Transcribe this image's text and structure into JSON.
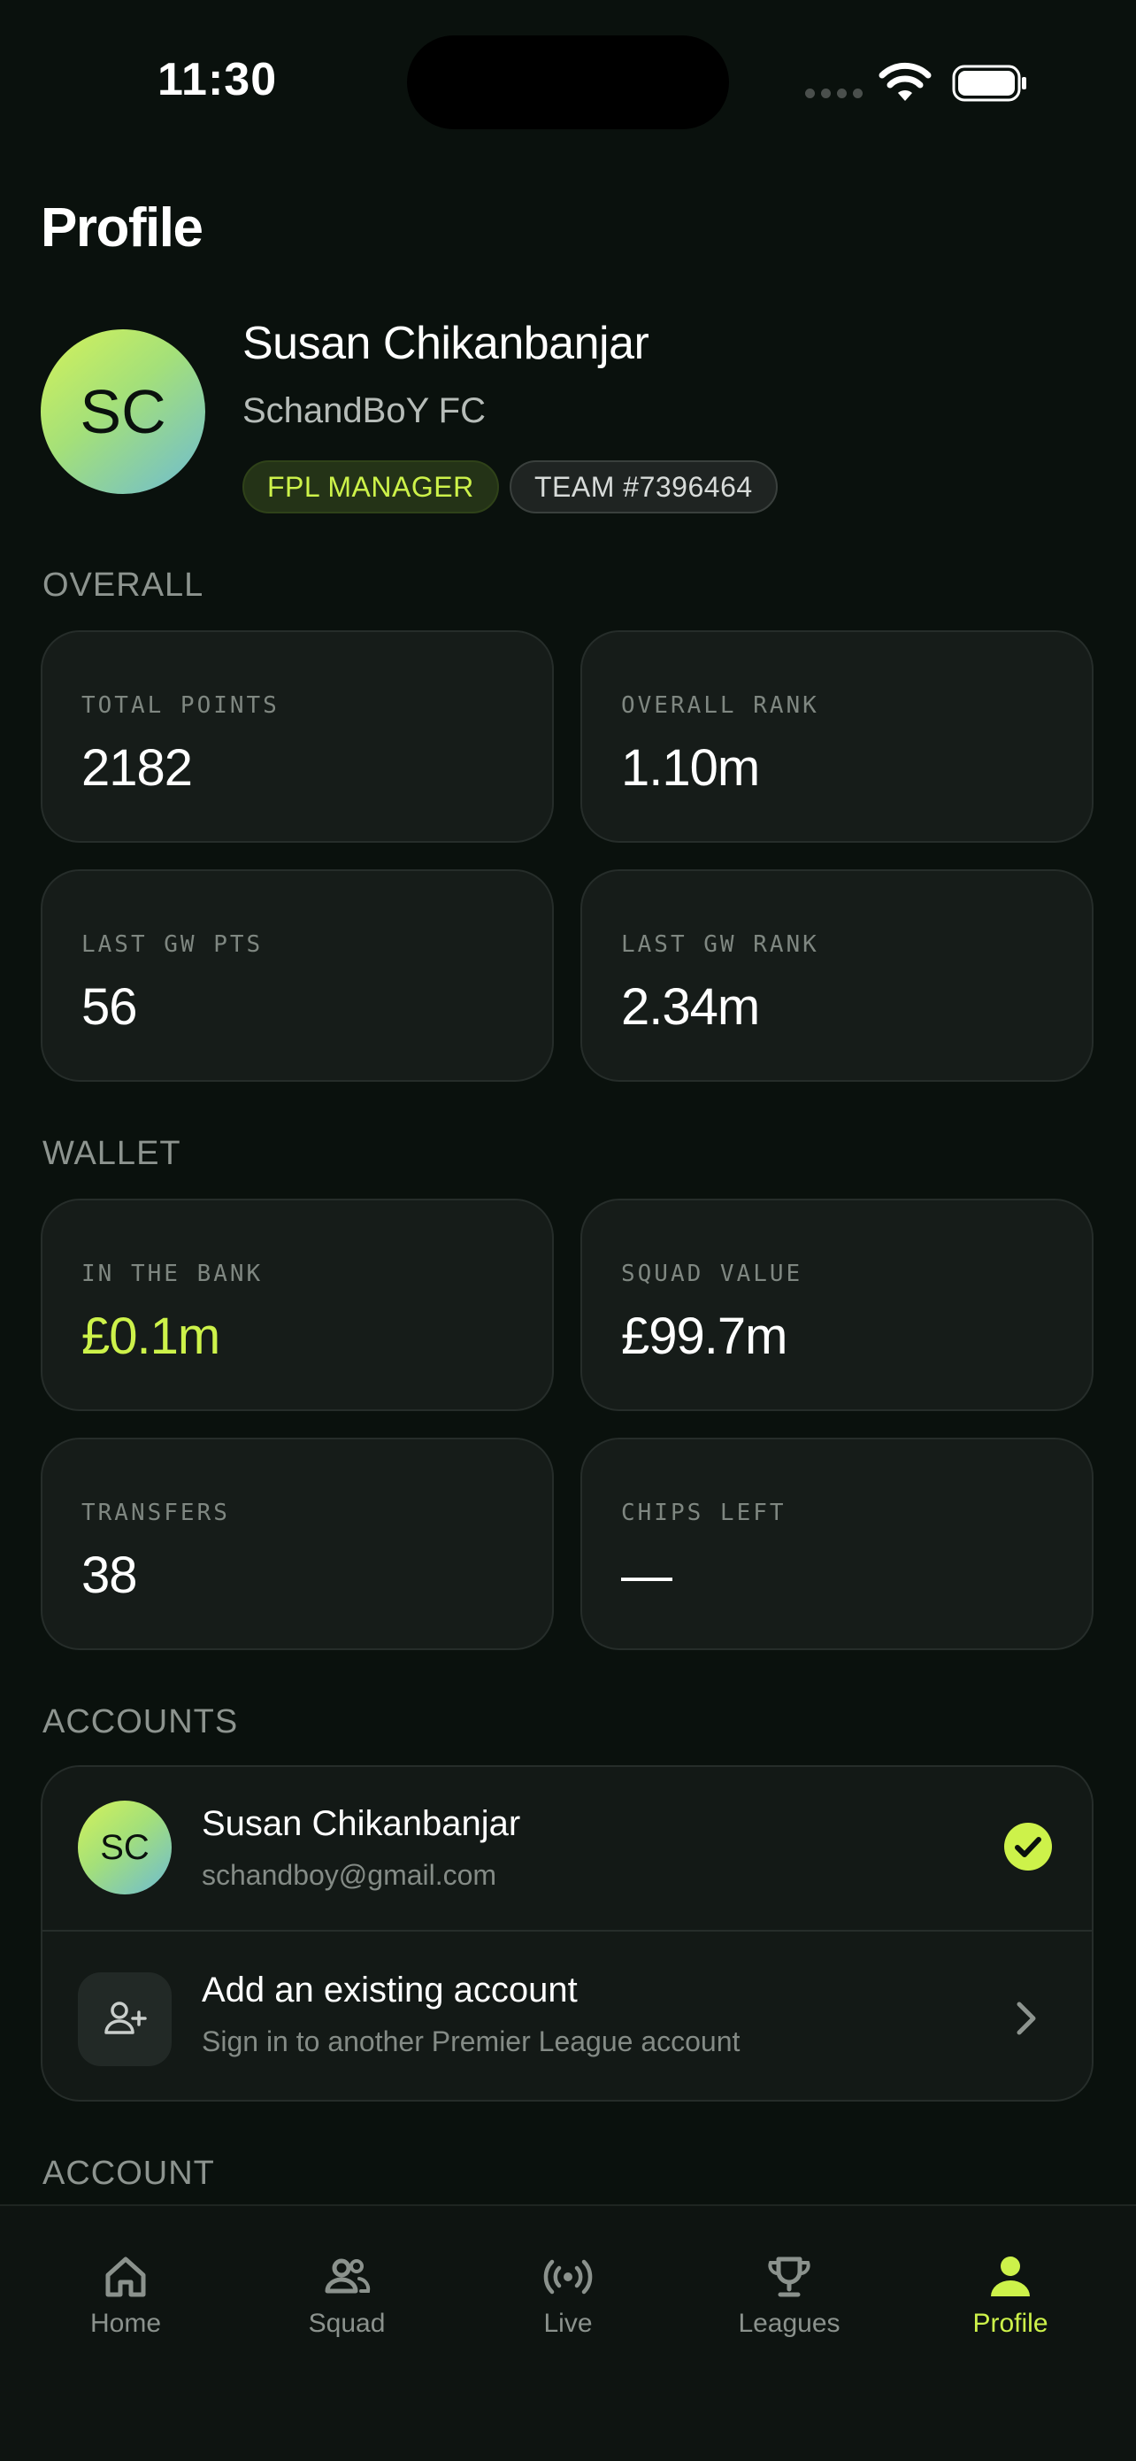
{
  "status_bar": {
    "time": "11:30"
  },
  "page": {
    "title": "Profile"
  },
  "profile": {
    "initials": "SC",
    "name": "Susan Chikanbanjar",
    "team_name": "SchandBoY FC",
    "badges": {
      "role": "FPL MANAGER",
      "team_id": "TEAM #7396464"
    }
  },
  "overall": {
    "label": "OVERALL",
    "cards": [
      {
        "key": "TOTAL POINTS",
        "value": "2182"
      },
      {
        "key": "OVERALL RANK",
        "value": "1.10m"
      },
      {
        "key": "LAST GW PTS",
        "value": "56"
      },
      {
        "key": "LAST GW RANK",
        "value": "2.34m"
      }
    ]
  },
  "wallet": {
    "label": "WALLET",
    "cards": [
      {
        "key": "IN THE BANK",
        "value": "£0.1m"
      },
      {
        "key": "SQUAD VALUE",
        "value": "£99.7m"
      },
      {
        "key": "TRANSFERS",
        "value": "38"
      },
      {
        "key": "CHIPS LEFT",
        "value": "—"
      }
    ]
  },
  "accounts": {
    "label": "ACCOUNTS",
    "current": {
      "initials": "SC",
      "name": "Susan Chikanbanjar",
      "email": "schandboy@gmail.com"
    },
    "add": {
      "title": "Add an existing account",
      "subtitle": "Sign in to another Premier League account"
    }
  },
  "account_section": {
    "label": "ACCOUNT"
  },
  "tabbar": {
    "tabs": [
      {
        "label": "Home",
        "icon": "home-icon"
      },
      {
        "label": "Squad",
        "icon": "squad-icon"
      },
      {
        "label": "Live",
        "icon": "live-icon"
      },
      {
        "label": "Leagues",
        "icon": "trophy-icon"
      },
      {
        "label": "Profile",
        "icon": "person-icon"
      }
    ],
    "active": "Profile"
  },
  "colors": {
    "background": "#0a110d",
    "accent": "#cdf24a",
    "card": "#161c19",
    "muted": "#8d948f"
  }
}
